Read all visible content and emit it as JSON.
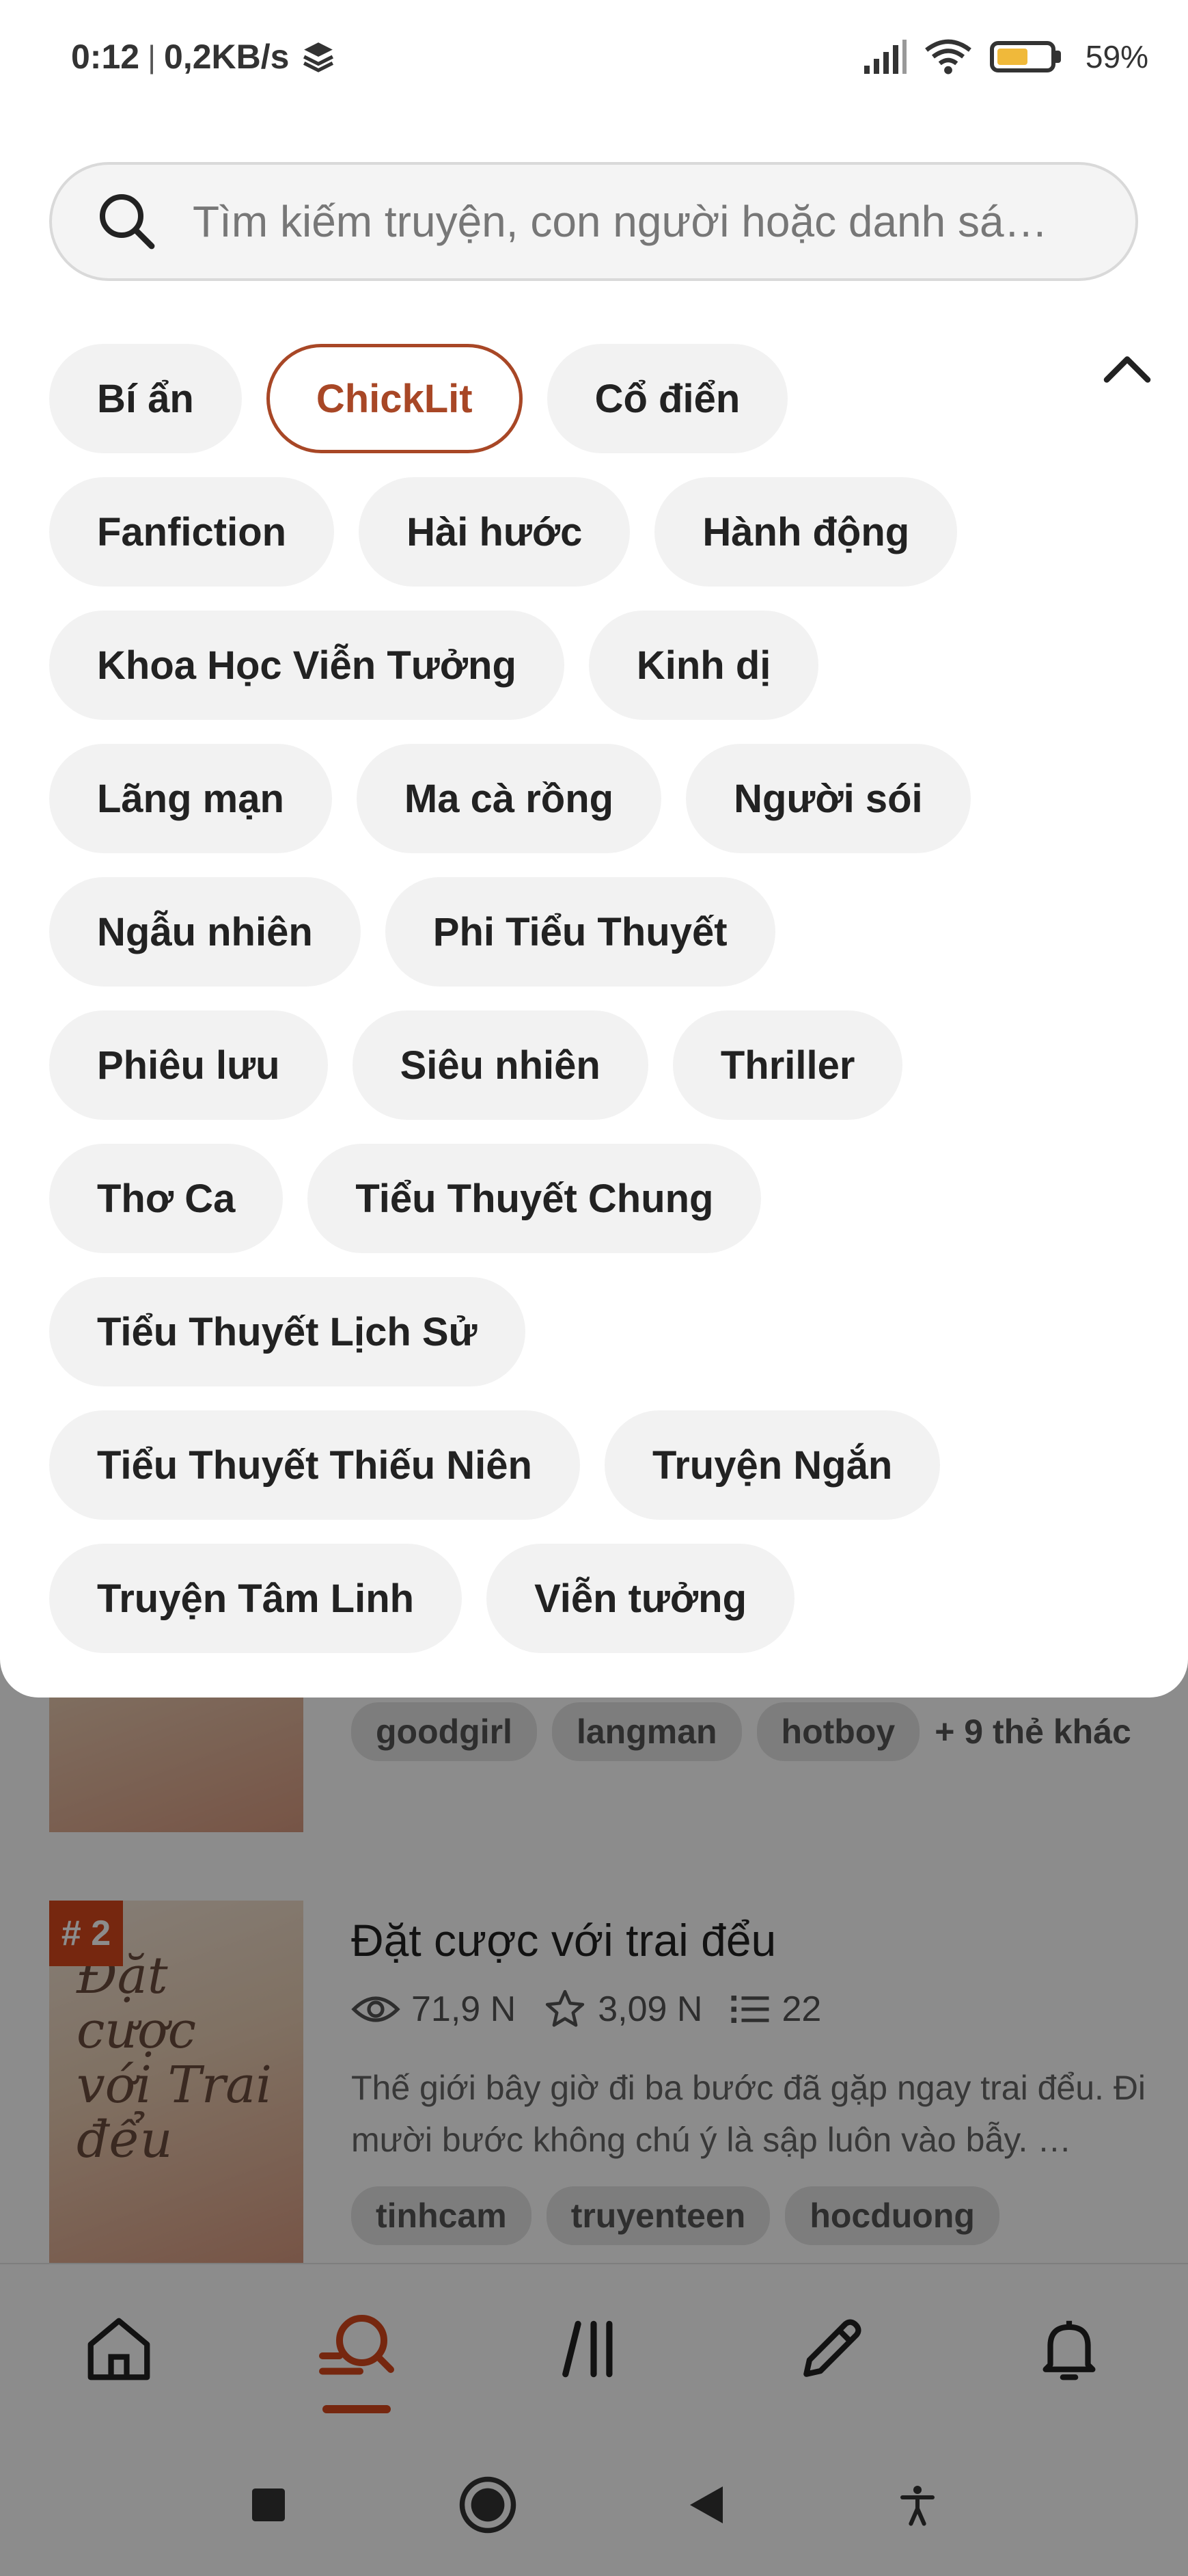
{
  "status_bar": {
    "time": "0:12",
    "separator": "|",
    "network_speed": "0,2KB/s",
    "battery_percent": "59%",
    "battery_level": 0.59,
    "battery_color": "#f0b93a"
  },
  "search": {
    "placeholder": "Tìm kiếm truyện, con người hoặc danh sá…",
    "icon": "search-icon"
  },
  "genres": {
    "selected": "ChickLit",
    "rows": [
      [
        "Bí ẩn",
        "ChickLit",
        "Cổ điển"
      ],
      [
        "Fanfiction",
        "Hài hước",
        "Hành động"
      ],
      [
        "Khoa Học Viễn Tưởng",
        "Kinh dị"
      ],
      [
        "Lãng mạn",
        "Ma cà rồng",
        "Người sói"
      ],
      [
        "Ngẫu nhiên",
        "Phi Tiểu Thuyết"
      ],
      [
        "Phiêu lưu",
        "Siêu nhiên",
        "Thriller"
      ],
      [
        "Thơ Ca",
        "Tiểu Thuyết Chung"
      ],
      [
        "Tiểu Thuyết Lịch Sử"
      ],
      [
        "Tiểu Thuyết Thiếu Niên",
        "Truyện Ngắn"
      ],
      [
        "Truyện Tâm Linh",
        "Viễn tưởng"
      ]
    ]
  },
  "stories": [
    {
      "tags": [
        "goodgirl",
        "langman",
        "hotboy"
      ],
      "more_tags": "+ 9 thẻ khác"
    },
    {
      "rank": "# 2",
      "cover_text": "Đặt cược với Trai đểu",
      "title": "Đặt cược với trai đểu",
      "views": "71,9 N",
      "votes": "3,09 N",
      "parts": "22",
      "description": "Thế giới bây giờ đi ba bước đã gặp ngay trai đểu. Đi mười bước không chú ý là sập luôn vào bẫy. …",
      "tags": [
        "tinhcam",
        "truyenteen",
        "hocduong"
      ]
    }
  ],
  "bottom_nav": {
    "items": [
      "home-icon",
      "search-icon",
      "library-icon",
      "write-icon",
      "notifications-icon"
    ],
    "active": "search-icon",
    "accent": "#d7471c"
  },
  "system_nav": [
    "recents-button",
    "home-button",
    "back-button",
    "accessibility-button"
  ]
}
